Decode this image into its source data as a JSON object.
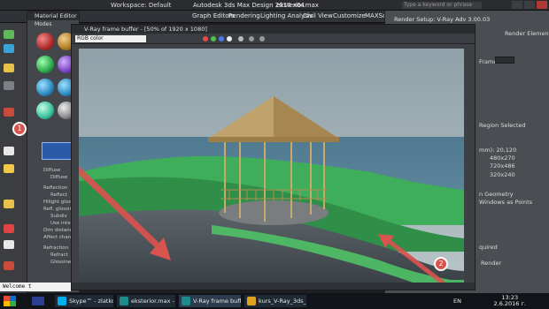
{
  "app": {
    "title": "Autodesk 3ds Max Design 2014 x64",
    "file": "eksterior.max",
    "workspace": "Workspace: Default",
    "search_placeholder": "Type a keyword or phrase"
  },
  "menus": [
    "Graph Editors",
    "Rendering",
    "Lighting Analysis",
    "Civil View",
    "Customize",
    "MAXScript"
  ],
  "material_editor": {
    "title": "Material Editor - voda",
    "menu": [
      "Modes",
      "Material"
    ],
    "params": [
      "Diffuse",
      "Diffuse",
      "Reflection",
      "Reflect",
      "Hilight gloss",
      "Refl. glossiness",
      "Subdiv",
      "Use interp",
      "Dim distance",
      "Affect channel",
      "Refraction",
      "Refract",
      "Glossiness"
    ]
  },
  "frame_buffer": {
    "title": "V-Ray frame buffer - [50% of 1920 x 1080]",
    "channel": "RGB color"
  },
  "render_setup": {
    "title": "Render Setup: V-Ray Adv 3.00.03",
    "tab": "Render Elements",
    "frame_label": "Frame:",
    "region_label": "Region Selected",
    "resolution_label": "mm): 20,120",
    "res_values": [
      "480x270",
      "720x486",
      "320x240"
    ],
    "geometry_label": "n Geometry",
    "windows_label": "Windows as Points",
    "render_label": "Render",
    "quired_label": "quired"
  },
  "annotations": [
    "1",
    "2"
  ],
  "console": "Welcome t",
  "taskbar": {
    "language": "EN",
    "items": [
      "Skype™ - zlatkov...",
      "eksterior.max - A...",
      "V-Ray frame buff...",
      "kurs_V-Ray_3ds_..."
    ],
    "time": "13:23",
    "date": "2.6.2016 г."
  },
  "colors": {
    "accent_arrow": "#d9534f",
    "grass": "#3fae5a",
    "water": "#545a61",
    "sky": "#9aa7ad"
  }
}
